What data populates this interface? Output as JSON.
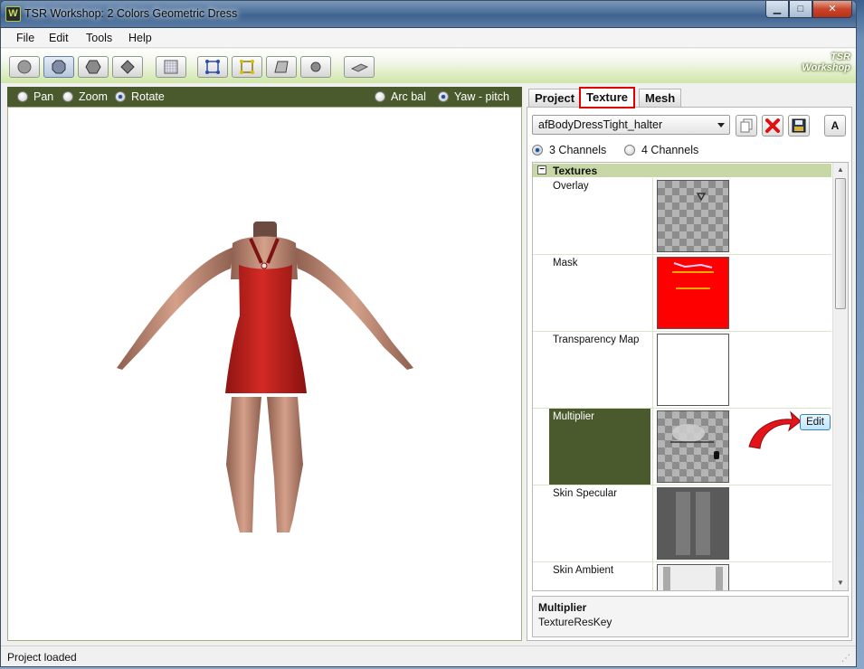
{
  "window": {
    "title": "TSR Workshop: 2 Colors Geometric Dress",
    "app_icon_letter": "W",
    "controls": {
      "minimize": "▁",
      "maximize": "□",
      "close": "✕"
    }
  },
  "menu": {
    "file": "File",
    "edit": "Edit",
    "tools": "Tools",
    "help": "Help"
  },
  "toolbar": {
    "buttons": [
      "sphere-view",
      "octagon-view",
      "hexagon-view",
      "diamond-view",
      "grid-view",
      "mesh-cube",
      "bone-cube",
      "floor-view",
      "circle-view",
      "plane-view"
    ],
    "logo_line1": "TSR",
    "logo_line2": "Workshop"
  },
  "viewport": {
    "modes": {
      "pan": "Pan",
      "zoom": "Zoom",
      "rotate": "Rotate",
      "selected": "rotate"
    },
    "camera": {
      "arcball": "Arc bal",
      "yaw_pitch": "Yaw - pitch",
      "selected": "yaw_pitch"
    },
    "background": "#ffffff",
    "dress_color": "#c8201c",
    "skin_color": "#c98c74"
  },
  "tabs": {
    "project": "Project",
    "texture": "Texture",
    "mesh": "Mesh",
    "active": "texture"
  },
  "texture_panel": {
    "mesh_select": "afBodyDressTight_halter",
    "channels": {
      "three": "3 Channels",
      "four": "4 Channels",
      "selected": "three"
    },
    "letter_button": "A",
    "group_title": "Textures",
    "rows": [
      {
        "name": "Overlay"
      },
      {
        "name": "Mask"
      },
      {
        "name": "Transparency Map"
      },
      {
        "name": "Multiplier",
        "edit_label": "Edit"
      },
      {
        "name": "Skin Specular"
      },
      {
        "name": "Skin Ambient"
      }
    ],
    "description": {
      "title": "Multiplier",
      "text": "TextureResKey"
    }
  },
  "status": {
    "text": "Project loaded"
  },
  "colors": {
    "accent_green": "#4a5a2c",
    "highlight_red": "#e00000",
    "mask_red": "#ff0000"
  }
}
